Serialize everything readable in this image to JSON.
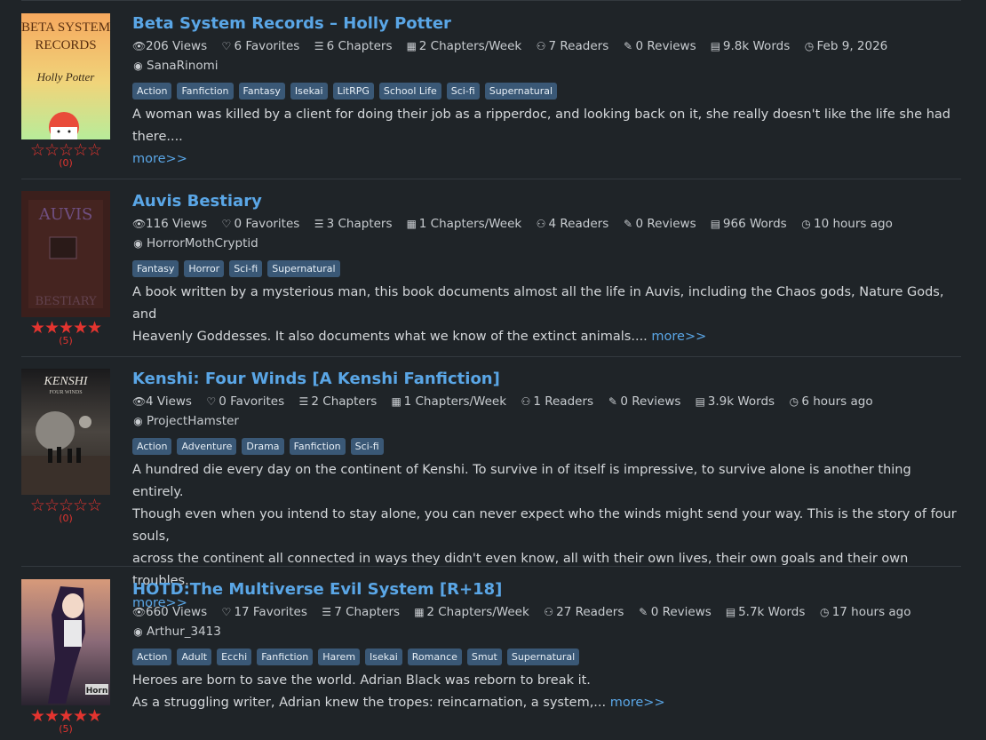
{
  "stories": [
    {
      "title": "Beta System Records – Holly Potter",
      "views": "206 Views",
      "favorites": "6 Favorites",
      "chapters": "6 Chapters",
      "rate": "2 Chapters/Week",
      "readers": "7 Readers",
      "reviews": "0 Reviews",
      "words": "9.8k Words",
      "updated": "Feb 9, 2026",
      "author": "SanaRinomi",
      "tags": [
        "Action",
        "Fanfiction",
        "Fantasy",
        "Isekai",
        "LitRPG",
        "School Life",
        "Sci-fi",
        "Supernatural"
      ],
      "description": [
        "A woman was killed by a client for doing their job as a ripperdoc, and looking back on it, she really doesn't like the life she had there...."
      ],
      "more": "more>>",
      "stars": "☆☆☆☆☆",
      "rating_count": "(0)",
      "cover": {
        "line1": "BETA SYSTEM",
        "line2": "RECORDS",
        "line3": "Holly Potter"
      }
    },
    {
      "title": "Auvis Bestiary",
      "views": "116 Views",
      "favorites": "0 Favorites",
      "chapters": "3 Chapters",
      "rate": "1 Chapters/Week",
      "readers": "4 Readers",
      "reviews": "0 Reviews",
      "words": "966 Words",
      "updated": "10 hours ago",
      "author": "HorrorMothCryptid",
      "tags": [
        "Fantasy",
        "Horror",
        "Sci-fi",
        "Supernatural"
      ],
      "description": [
        "A book written by a mysterious man, this book documents almost all the life in Auvis, including the Chaos gods, Nature Gods, and",
        "Heavenly Goddesses. It also documents what we know of the extinct animals.... "
      ],
      "more": "more>>",
      "stars": "★★★★★",
      "rating_count": "(5)",
      "cover": {
        "line1": "AUVIS",
        "line2": "BESTIARY"
      }
    },
    {
      "title": "Kenshi: Four Winds [A Kenshi Fanfiction]",
      "views": "4 Views",
      "favorites": "0 Favorites",
      "chapters": "2 Chapters",
      "rate": "1 Chapters/Week",
      "readers": "1 Readers",
      "reviews": "0 Reviews",
      "words": "3.9k Words",
      "updated": "6 hours ago",
      "author": "ProjectHamster",
      "tags": [
        "Action",
        "Adventure",
        "Drama",
        "Fanfiction",
        "Sci-fi"
      ],
      "description": [
        "A hundred die every day on the continent of Kenshi. To survive in of itself is impressive, to survive alone is another thing entirely.",
        "Though even when you intend to stay alone, you can never expect who the winds might send your way. This is the story of four souls,",
        "across the continent all connected in ways they didn't even know, all with their own lives, their own goals and their own troubles. ..."
      ],
      "more": "more>>",
      "stars": "☆☆☆☆☆",
      "rating_count": "(0)",
      "cover": {
        "line1": "KENSHI",
        "line2": "FOUR WINDS"
      }
    },
    {
      "title": "HOTD:The Multiverse Evil System [R+18]",
      "views": "660 Views",
      "favorites": "17 Favorites",
      "chapters": "7 Chapters",
      "rate": "2 Chapters/Week",
      "readers": "27 Readers",
      "reviews": "0 Reviews",
      "words": "5.7k Words",
      "updated": "17 hours ago",
      "author": "Arthur_3413",
      "tags": [
        "Action",
        "Adult",
        "Ecchi",
        "Fanfiction",
        "Harem",
        "Isekai",
        "Romance",
        "Smut",
        "Supernatural"
      ],
      "description": [
        "Heroes are born to save the world. Adrian Black was reborn to break it.",
        "As a struggling writer, Adrian knew the tropes: reincarnation, a system,... "
      ],
      "more": "more>>",
      "stars": "★★★★★",
      "rating_count": "(5)",
      "cover": {
        "line1": "Horn"
      }
    }
  ],
  "icons": {
    "views": "eye-icon",
    "favorites": "heart-icon",
    "chapters": "list-icon",
    "rate": "calendar-icon",
    "readers": "user-outline-icon",
    "reviews": "edit-icon",
    "words": "book-icon",
    "updated": "clock-icon",
    "author": "user-circle-icon"
  },
  "colors": {
    "background": "#1f2428",
    "link": "#5aa6e6",
    "tag_bg": "#3a5876",
    "star": "#e3342f"
  }
}
